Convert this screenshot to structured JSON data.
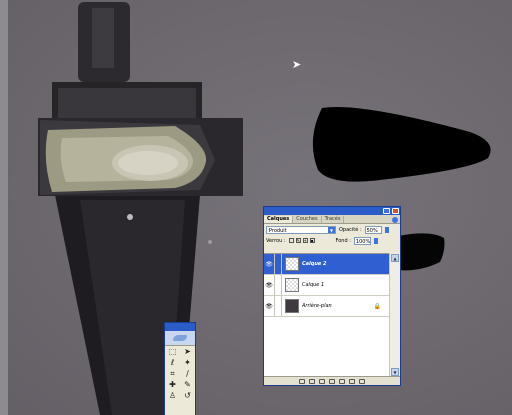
{
  "layers_panel": {
    "tabs": [
      "Calques",
      "Couches",
      "Tracés"
    ],
    "blend_mode": "Produit",
    "opacity_label": "Opacité :",
    "opacity_value": "50%",
    "lock_label": "Verrou :",
    "fill_label": "Fond :",
    "fill_value": "100%",
    "layers": [
      {
        "name": "Calque 2",
        "selected": true,
        "visible": true
      },
      {
        "name": "Calque 1",
        "selected": false,
        "visible": true
      },
      {
        "name": "Arrière-plan",
        "selected": false,
        "visible": true,
        "locked": true
      }
    ]
  },
  "tools_panel": {
    "tools": [
      "marquee-tool",
      "move-tool",
      "lasso-tool",
      "magic-wand-tool",
      "crop-tool",
      "slice-tool",
      "healing-brush-tool",
      "brush-tool",
      "stamp-tool",
      "history-brush-tool"
    ]
  },
  "colors": {
    "canvas": "#6f6a70",
    "titlebar": "#2b5cc8",
    "selection": "#2f5fd0",
    "panel": "#ece9d8"
  }
}
